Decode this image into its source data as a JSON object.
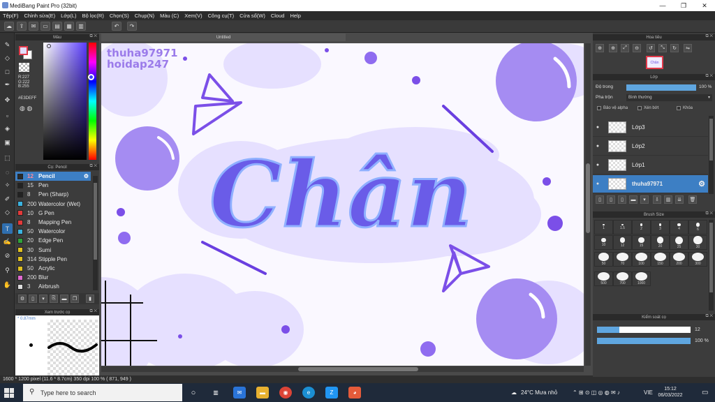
{
  "window": {
    "title": "MediBang Paint Pro (32bit)",
    "minimize": "—",
    "maximize": "❐",
    "close": "✕"
  },
  "menu": [
    "Tệp(F)",
    "Chỉnh sửa(E)",
    "Lớp(L)",
    "Bộ lọc(R)",
    "Chọn(S)",
    "Chụp(N)",
    "Màu (C)",
    "Xem(V)",
    "Công cụ(T)",
    "Cửa sổ(W)",
    "Cloud",
    "Help"
  ],
  "panels": {
    "color": "Màu",
    "brush": "Cọ: Pencil",
    "preview": "Xem trước cọ",
    "navigator": "Hoa tiêu",
    "layer": "Lớp",
    "brush_size": "Brush Size",
    "brush_control": "Kiểm soát cọ"
  },
  "document": {
    "tab": "Untitled",
    "watermark_line1": "thuha97971",
    "watermark_line2": "hoidap247"
  },
  "color": {
    "r": "R:227",
    "g": "G:222",
    "b": "B:255",
    "hex": "#E3DEFF",
    "fg": "#E3DEFF",
    "accent": "#3d7fc4"
  },
  "brushes": [
    {
      "size": "12",
      "name": "Pencil",
      "color": "#2b2b2b",
      "active": true
    },
    {
      "size": "15",
      "name": "Pen",
      "color": "#222222"
    },
    {
      "size": "8",
      "name": "Pen (Sharp)",
      "color": "#222222"
    },
    {
      "size": "200",
      "name": "Watercolor (Wet)",
      "color": "#3bb3e0"
    },
    {
      "size": "10",
      "name": "G Pen",
      "color": "#e23a3a"
    },
    {
      "size": "8",
      "name": "Mapping Pen",
      "color": "#e23a3a"
    },
    {
      "size": "50",
      "name": "Watercolor",
      "color": "#3bb3e0"
    },
    {
      "size": "20",
      "name": "Edge Pen",
      "color": "#2fa23a"
    },
    {
      "size": "30",
      "name": "Sumi",
      "color": "#e0c020"
    },
    {
      "size": "314",
      "name": "Stipple Pen",
      "color": "#e0c020"
    },
    {
      "size": "50",
      "name": "Acrylic",
      "color": "#e0c020"
    },
    {
      "size": "200",
      "name": "Blur",
      "color": "#e06ad0"
    },
    {
      "size": "3",
      "name": "Airbrush",
      "color": "#dddddd"
    }
  ],
  "preview": {
    "size": "0.87mm"
  },
  "layer": {
    "opacity_label": "Độ trong",
    "opacity_value": "100 %",
    "opacity_fraction": 1.0,
    "blend_label": "Pha trộn",
    "blend_value": "Bình thường",
    "protect_alpha": "Bảo vệ alpha",
    "clipping": "Xén bớt",
    "lock": "Khóa",
    "items": [
      {
        "name": "Lớp3",
        "active": false
      },
      {
        "name": "Lớp2",
        "active": false
      },
      {
        "name": "Lớp1",
        "active": false
      },
      {
        "name": "thuha97971",
        "active": true
      }
    ]
  },
  "brush_sizes": [
    "1",
    "1.5",
    "2",
    "3",
    "4",
    "6",
    "10",
    "12",
    "15",
    "20",
    "25",
    "30",
    "50",
    "70",
    "100",
    "150",
    "200",
    "300",
    "500",
    "700",
    "1000"
  ],
  "brush_control": {
    "size_value": "12",
    "size_fraction": 0.24,
    "opacity_value": "100 %",
    "opacity_fraction": 1.0
  },
  "status": {
    "text": "1600 * 1200 pixel   (11.6 * 8.7cm)   350 dpi   100 %   ( 871, 949 )"
  },
  "taskbar": {
    "search_placeholder": "Type here to search",
    "weather": "24°C  Mưa nhỏ",
    "lang": "VIE",
    "time": "15:12",
    "date": "06/03/2022"
  }
}
